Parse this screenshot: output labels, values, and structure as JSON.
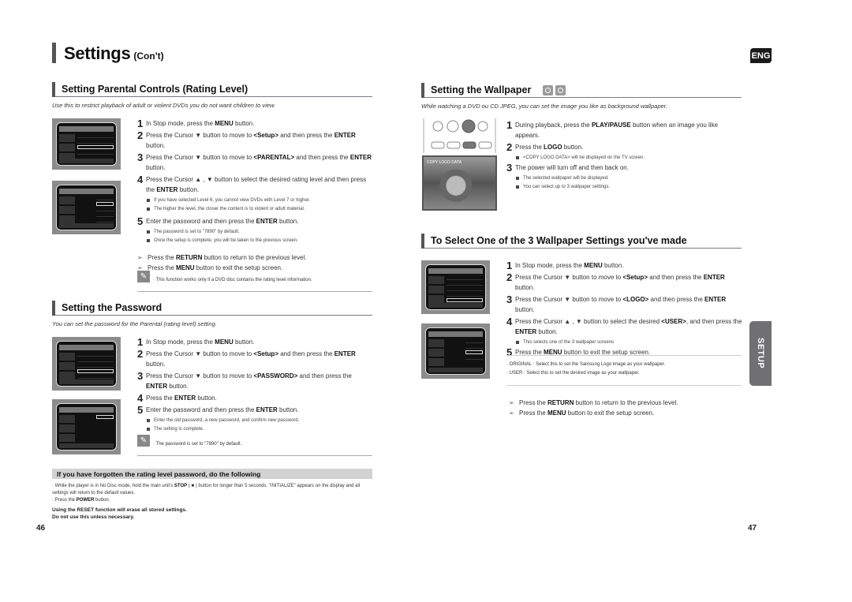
{
  "header": {
    "title": "Settings",
    "title_suffix": "(Con't)",
    "language_badge": "ENG"
  },
  "parental": {
    "title": "Setting Parental Controls (Rating Level)",
    "intro": "Use this to restrict playback of adult or violent DVDs you do not want children to view.",
    "steps": [
      {
        "num": "1",
        "pre": "In Stop mode, press the ",
        "bold": "MENU",
        "post": " button."
      },
      {
        "num": "2",
        "pre": "Press the Cursor ▼ button to move to ",
        "bold": "<Setup>",
        "mid": " and then press the ",
        "bold2": "ENTER",
        "post": " button."
      },
      {
        "num": "3",
        "pre": "Press the Cursor ▼ button to move to ",
        "bold": "<PARENTAL>",
        "mid": " and then press the ",
        "bold2": "ENTER",
        "post": " button."
      },
      {
        "num": "4",
        "pre": "Press the Cursor ▲ , ▼ button to select the desired rating level and then press the ",
        "bold": "ENTER",
        "post": " button."
      },
      {
        "num": "5",
        "pre": "Enter the password and then press the ",
        "bold": "ENTER",
        "post": " button."
      }
    ],
    "step4_bullets": [
      "If you have selected Level 6, you cannot view DVDs with Level 7 or higher.",
      "The higher the level, the closer the content is to violent or adult material."
    ],
    "step5_bullets": [
      "The password is set to \"7890\" by default.",
      "Once the setup is complete, you will be taken to the previous screen."
    ],
    "arrows": [
      {
        "pre": "Press the ",
        "bold": "RETURN",
        "post": " button to return to the previous level."
      },
      {
        "pre": "Press the ",
        "bold": "MENU",
        "post": " button to exit the setup screen."
      }
    ],
    "note": "· This function works only if a DVD disc contains the rating level information."
  },
  "password": {
    "title": "Setting the Password",
    "intro": "You can set the password for the Parental (rating level) setting.",
    "steps": [
      {
        "num": "1",
        "pre": "In Stop mode, press the ",
        "bold": "MENU",
        "post": " button."
      },
      {
        "num": "2",
        "pre": "Press the Cursor ▼ button to move to ",
        "bold": "<Setup>",
        "mid": " and then press the ",
        "bold2": "ENTER",
        "post": " button."
      },
      {
        "num": "3",
        "pre": "Press the Cursor ▼ button to move to ",
        "bold": "<PASSWORD>",
        "mid": " and then press the ",
        "bold2": "ENTER",
        "post": " button."
      },
      {
        "num": "4",
        "pre": "Press the ",
        "bold": "ENTER",
        "post": " button."
      },
      {
        "num": "5",
        "pre": "Enter the password and then press the ",
        "bold": "ENTER",
        "post": " button."
      }
    ],
    "step5_bullets": [
      "Enter the old password, a new password, and confirm new password.",
      "The setting is complete."
    ],
    "note": "· The password is set to \"7890\" by default."
  },
  "forgot": {
    "title": "If you have forgotten the rating level password, do the following",
    "line1_pre": "· While the player is in No Disc mode, hold the main unit's ",
    "line1_bold": "STOP",
    "line1_post": " ( ■ )  button for longer than 5 seconds. \"INITIALIZE\" appears on the display and all settings will return to the default values.",
    "line2_pre": "· Press the ",
    "line2_bold": "POWER",
    "line2_post": " button.",
    "warning1": "Using the RESET function will erase all stored settings.",
    "warning2": "Do not use this unless necessary."
  },
  "wallpaper": {
    "title": "Setting the Wallpaper",
    "badges": [
      "DVD",
      "JPEG"
    ],
    "intro": "While watching a DVD ou CD JPEG, you can set the image you like as background wallpaper.",
    "photo_caption": "COPY LOGO DATA",
    "steps": [
      {
        "num": "1",
        "pre": "During playback, press the ",
        "bold": "PLAY/PAUSE",
        "post": " button when an image you like appears."
      },
      {
        "num": "2",
        "pre": "Press the ",
        "bold": "LOGO",
        "post": " button."
      },
      {
        "num": "3",
        "pre": "The power will turn off and then back on.",
        "bold": "",
        "post": ""
      }
    ],
    "step2_bullets": [
      "<COPY LOGO DATA> will be displayed on the TV screen."
    ],
    "step3_bullets": [
      "The selected wallpaper will be displayed.",
      "You can select up to 3 wallpaper settings."
    ]
  },
  "select_wallpaper": {
    "title": "To Select One of the 3 Wallpaper Settings you've made",
    "steps": [
      {
        "num": "1",
        "pre": "In Stop mode, press the ",
        "bold": "MENU",
        "post": " button."
      },
      {
        "num": "2",
        "pre": "Press the Cursor ▼ button to move to ",
        "bold": "<Setup>",
        "mid": " and then press the ",
        "bold2": "ENTER",
        "post": " button."
      },
      {
        "num": "3",
        "pre": "Press the Cursor ▼ button to move to ",
        "bold": "<LOGO>",
        "mid": " and then press the ",
        "bold2": "ENTER",
        "post": " button."
      },
      {
        "num": "4",
        "pre": "Press the Cursor ▲ , ▼ button to select the desired ",
        "bold": "<USER>",
        "mid": ", and then press the ",
        "bold2": "ENTER",
        "post": " button."
      },
      {
        "num": "5",
        "pre": "Press the ",
        "bold": "MENU",
        "post": " button to exit the setup screen."
      }
    ],
    "step4_bullets": [
      "This selects one of the 3 wallpaper screens"
    ],
    "notes": [
      "· ORIGINAL : Select this to set the Samsung Logo image as your wallpaper.",
      "· USER : Select this to set the desired image as your wallpaper."
    ],
    "arrows": [
      {
        "pre": "Press the ",
        "bold": "RETURN",
        "post": " button to return to the previous level."
      },
      {
        "pre": "Press the ",
        "bold": "MENU",
        "post": " button to exit the setup screen."
      }
    ]
  },
  "side_tab": "SETUP",
  "page_numbers": {
    "left": "46",
    "right": "47"
  },
  "icons": {
    "arrow": "➢",
    "note": "✎"
  }
}
